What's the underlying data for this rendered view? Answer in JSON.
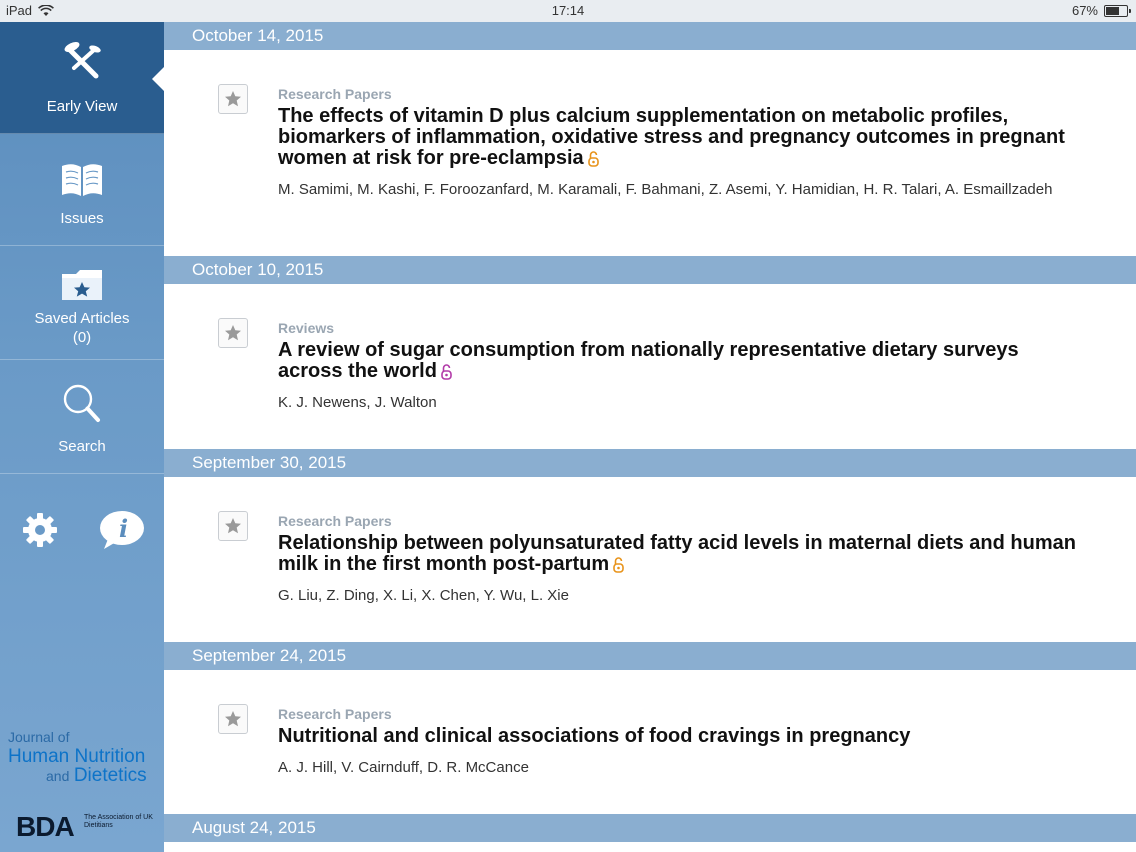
{
  "status_bar": {
    "device": "iPad",
    "time": "17:14",
    "battery": "67%",
    "battery_level": 0.67
  },
  "sidebar": {
    "nav": [
      {
        "label": "Early View",
        "icon": "early-view-icon"
      },
      {
        "label": "Issues",
        "icon": "book-icon"
      },
      {
        "label": "Saved Articles",
        "count": "(0)",
        "icon": "folder-star-icon"
      },
      {
        "label": "Search",
        "icon": "search-icon"
      }
    ],
    "settings_icon": "gear-icon",
    "info_icon": "info-icon",
    "journal": {
      "line1": "Journal of",
      "line2": "Human Nutrition",
      "line3_small": "and",
      "line3_big": "Dietetics"
    },
    "bda": {
      "mark": "BDA",
      "subtitle": "The Association of UK Dietitians"
    }
  },
  "feed": [
    {
      "date": "October 14, 2015",
      "category": "Research Papers",
      "title": "The effects of vitamin D plus calcium supplementation on metabolic profiles, biomarkers of inflammation, oxidative stress and pregnancy outcomes in pregnant women at risk for pre-eclampsia",
      "authors": "M. Samimi, M. Kashi, F. Foroozanfard, M. Karamali, F. Bahmani, Z. Asemi, Y. Hamidian, H. R. Talari, A. Esmaillzadeh",
      "open_access_color": "#e8931a"
    },
    {
      "date": "October 10, 2015",
      "category": "Reviews",
      "title": "A review of sugar consumption from nationally representative dietary surveys across the world",
      "authors": "K. J. Newens, J. Walton",
      "open_access_color": "#b23aa8"
    },
    {
      "date": "September 30, 2015",
      "category": "Research Papers",
      "title": "Relationship between polyunsaturated fatty acid levels in maternal diets and human milk in the first month post-partum",
      "authors": "G. Liu, Z. Ding, X. Li, X. Chen, Y. Wu, L. Xie",
      "open_access_color": "#e8931a"
    },
    {
      "date": "September 24, 2015",
      "category": "Research Papers",
      "title": "Nutritional and clinical associations of food cravings in pregnancy",
      "authors": "A. J. Hill, V. Cairnduff, D. R. McCance"
    }
  ],
  "next_date": "August 24, 2015",
  "colors": {
    "sidebar": "#5b8dbd",
    "active": "#2a5d8f",
    "date_header": "#8aaed0"
  }
}
